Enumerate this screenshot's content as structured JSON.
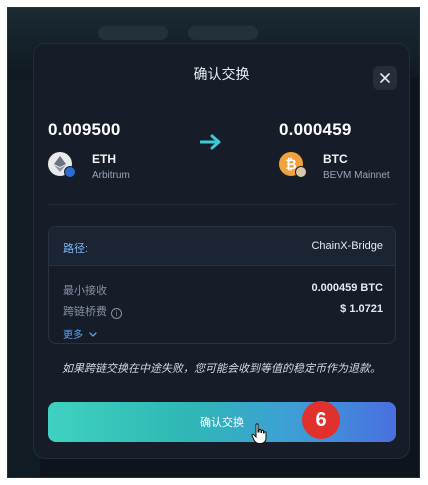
{
  "modal": {
    "title": "确认交换",
    "from": {
      "amount": "0.009500",
      "symbol": "ETH",
      "network": "Arbitrum",
      "icon": "eth-icon"
    },
    "to": {
      "amount": "0.000459",
      "symbol": "BTC",
      "network": "BEVM Mainnet",
      "icon": "btc-icon"
    },
    "route": {
      "label": "路径:",
      "value": "ChainX-Bridge"
    },
    "details": [
      {
        "label": "最小接收",
        "value": "0.000459 BTC"
      },
      {
        "label": "跨链桥费",
        "value": "$ 1.0721"
      }
    ],
    "more_label": "更多",
    "notice": "如果跨链交换在中途失败，您可能会收到等值的稳定币作为退款。",
    "confirm_label": "确认交换"
  },
  "annotation": {
    "step_number": "6"
  },
  "colors": {
    "accent": "#3fd2c0",
    "link": "#5aa3f0",
    "badge": "#e0312c"
  }
}
